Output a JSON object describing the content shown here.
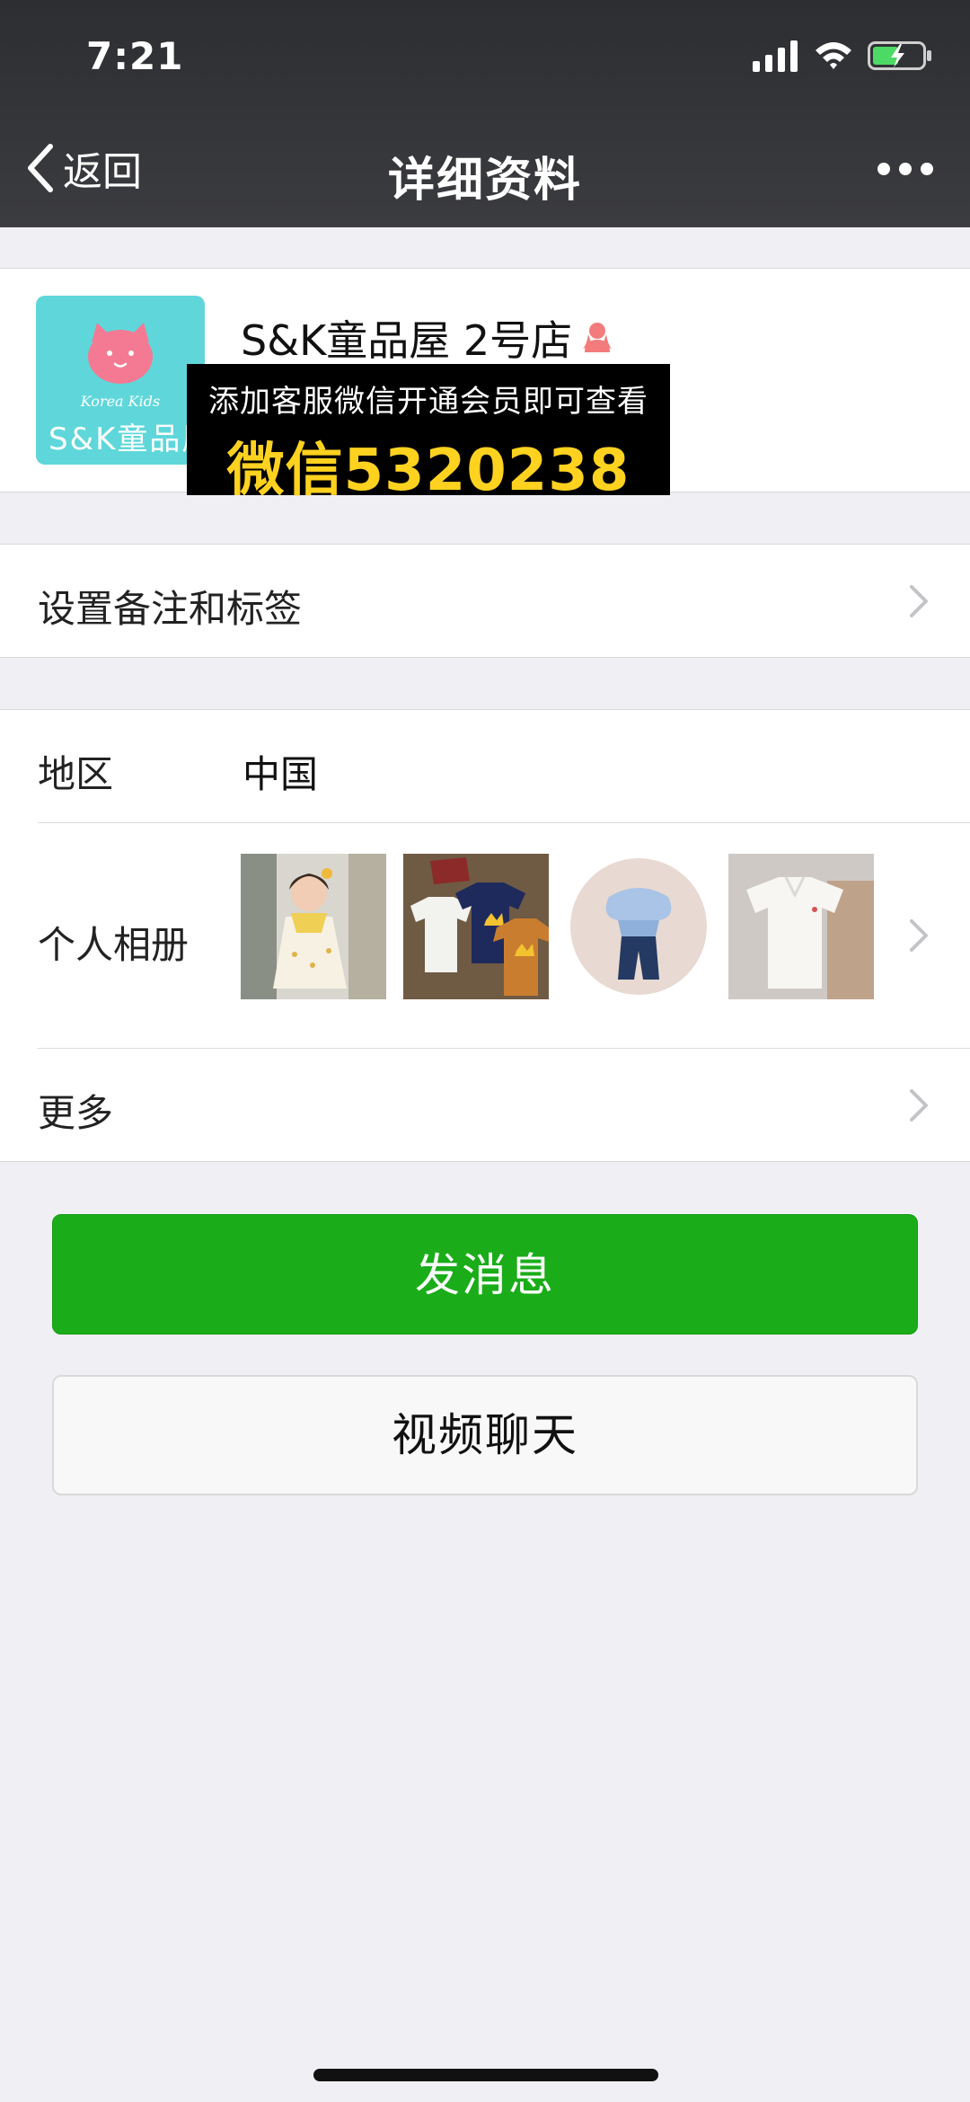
{
  "status_bar": {
    "time": "7:21"
  },
  "nav": {
    "back_label": "返回",
    "title": "详细资料"
  },
  "profile": {
    "name": "S&K童品屋 2号店",
    "avatar_subtext": "Korea Kids",
    "avatar_brand": "S&K童品屋",
    "watermark_line1": "添加客服微信开通会员即可查看",
    "watermark_line2": "微信5320238"
  },
  "list": {
    "remark_label": "设置备注和标签",
    "region_label": "地区",
    "region_value": "中国",
    "album_label": "个人相册",
    "more_label": "更多"
  },
  "buttons": {
    "send_message": "发消息",
    "video_chat": "视频聊天"
  },
  "colors": {
    "nav_bg": "#38393d",
    "page_bg": "#efeff4",
    "primary_green": "#1aad19",
    "avatar_bg": "#5fd7da",
    "watermark_yellow": "#ffd21f",
    "female_icon": "#f37b7b"
  }
}
